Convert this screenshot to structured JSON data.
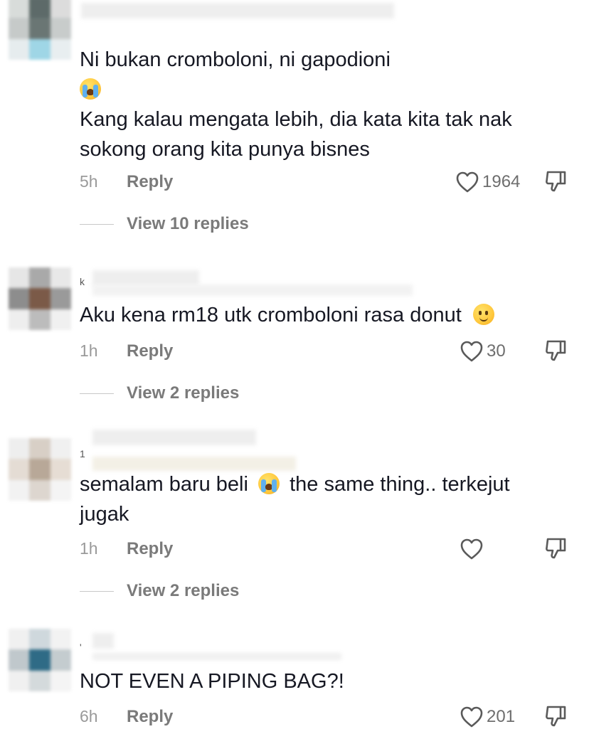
{
  "comments": [
    {
      "text_lines": [
        "Ni bukan cromboloni, ni gapodioni",
        "",
        "Kang kalau mengata lebih, dia kata kita tak nak",
        "sokong orang kita punya bisnes"
      ],
      "time": "5h",
      "reply_label": "Reply",
      "likes": "1964",
      "view_replies": "View 10 replies",
      "emoji": "loudly-crying-face"
    },
    {
      "initial": "k",
      "text": "Aku kena rm18 utk cromboloni rasa donut",
      "emoji": "melting-face",
      "time": "1h",
      "reply_label": "Reply",
      "likes": "30",
      "view_replies": "View 2 replies"
    },
    {
      "initial": "1",
      "text_before": "semalam baru beli",
      "emoji": "loudly-crying-face",
      "text_after": "the same thing.. terkejut",
      "text_line2": "jugak",
      "time": "1h",
      "reply_label": "Reply",
      "likes": "",
      "view_replies": "View 2 replies"
    },
    {
      "initial": "'",
      "text": "NOT EVEN A PIPING BAG?!",
      "time": "6h",
      "reply_label": "Reply",
      "likes": "201"
    }
  ],
  "icons": {
    "like": "heart-outline-icon",
    "dislike": "thumbs-down-icon"
  },
  "colors": {
    "text": "#161823",
    "meta": "#7a7a7a",
    "time": "#9a9a9a"
  }
}
